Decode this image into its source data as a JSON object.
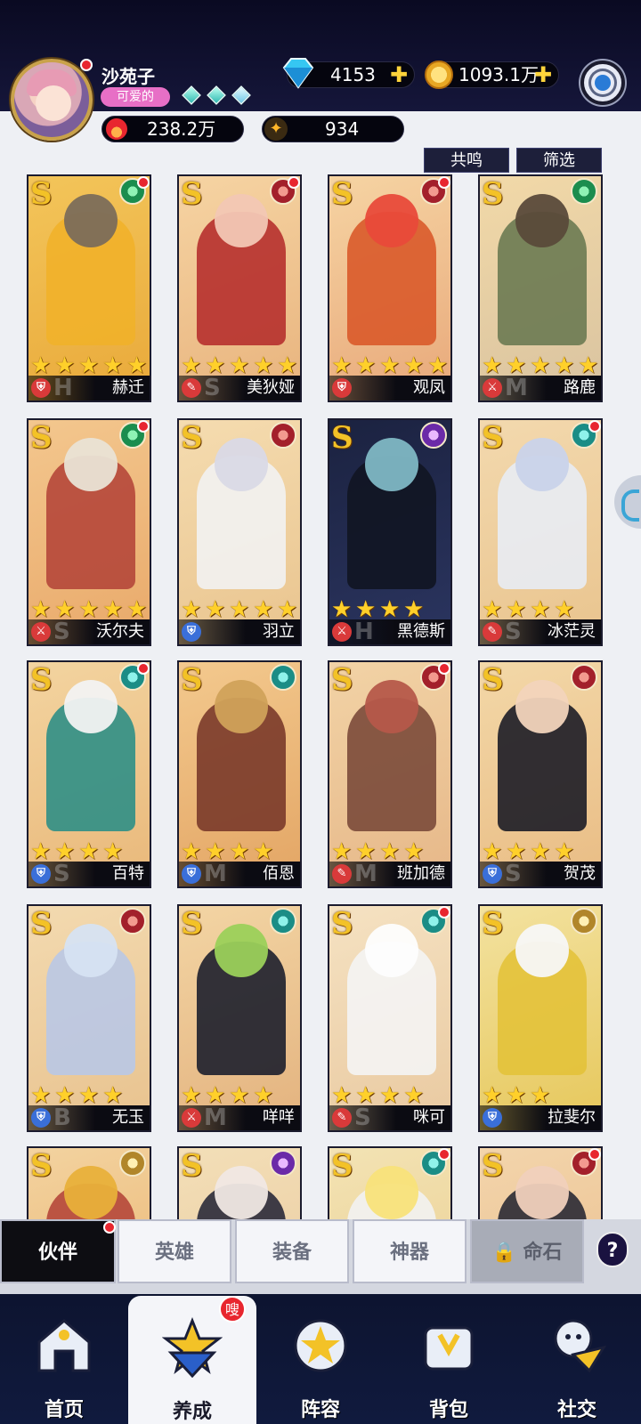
{
  "player": {
    "name": "沙苑子",
    "title": "可爱的",
    "diamonds": "4153",
    "gold": "1093.1万",
    "power": "238.2万",
    "stars": "934"
  },
  "buttons": {
    "resonance": "共鸣",
    "filter": "筛选"
  },
  "heroes": [
    {
      "name": "赫迁",
      "grade": "S",
      "element": "green",
      "role": "shield",
      "stars": 5,
      "letters": "H",
      "dot": true,
      "bg": [
        "#f3c55a",
        "#e9a93a"
      ],
      "fig": "#f1b12a",
      "head": "#7b6d5a"
    },
    {
      "name": "美狄娅",
      "grade": "S",
      "element": "red",
      "role": "wand",
      "stars": 5,
      "letters": "S",
      "dot": true,
      "bg": [
        "#f6d4a3",
        "#e8b37d"
      ],
      "fig": "#b6302e",
      "head": "#f2c7b4"
    },
    {
      "name": "观凤",
      "grade": "S",
      "element": "red",
      "role": "shield",
      "stars": 5,
      "letters": "",
      "dot": true,
      "bg": [
        "#f6d4a3",
        "#e8a87a"
      ],
      "fig": "#d95a2a",
      "head": "#e84a3a"
    },
    {
      "name": "路鹿",
      "grade": "S",
      "element": "green",
      "role": "sword",
      "stars": 5,
      "letters": "M",
      "dot": false,
      "bg": [
        "#f2d9a8",
        "#d9c3a0"
      ],
      "fig": "#6b7a52",
      "head": "#5a4a3a"
    },
    {
      "name": "沃尔夫",
      "grade": "S",
      "element": "green",
      "role": "sword",
      "stars": 5,
      "letters": "S",
      "dot": true,
      "bg": [
        "#f3c78e",
        "#e9a96a"
      ],
      "fig": "#b5473a",
      "head": "#e9e3d5"
    },
    {
      "name": "羽立",
      "grade": "S",
      "element": "red",
      "role": "blue",
      "stars": 5,
      "letters": "",
      "dot": false,
      "bg": [
        "#f5dcb0",
        "#e9c48e"
      ],
      "fig": "#f2f2f2",
      "head": "#d9d9e6"
    },
    {
      "name": "黑德斯",
      "grade": "S",
      "element": "purple",
      "role": "sword",
      "stars": 4,
      "letters": "H",
      "dot": false,
      "bg": [
        "#1b2240",
        "#2b3560"
      ],
      "fig": "#111522",
      "head": "#7fb7c4"
    },
    {
      "name": "冰茫灵",
      "grade": "S",
      "element": "teal",
      "role": "wand",
      "stars": 4,
      "letters": "S",
      "dot": true,
      "bg": [
        "#f3d9ae",
        "#e9c48e"
      ],
      "fig": "#e8ecf4",
      "head": "#c9d3ea"
    },
    {
      "name": "百特",
      "grade": "S",
      "element": "teal",
      "role": "blue",
      "stars": 4,
      "letters": "S",
      "dot": true,
      "bg": [
        "#f3d4a0",
        "#e9b87a"
      ],
      "fig": "#2f8f86",
      "head": "#f2f2f2"
    },
    {
      "name": "佰恩",
      "grade": "S",
      "element": "teal",
      "role": "blue",
      "stars": 4,
      "letters": "M",
      "dot": false,
      "bg": [
        "#f3c98e",
        "#e3a564"
      ],
      "fig": "#7a3a2a",
      "head": "#d0a25a"
    },
    {
      "name": "班加德",
      "grade": "S",
      "element": "red",
      "role": "wand",
      "stars": 4,
      "letters": "M",
      "dot": true,
      "bg": [
        "#f2d3a6",
        "#e6b788"
      ],
      "fig": "#7b4a3a",
      "head": "#b5584a"
    },
    {
      "name": "贺茂",
      "grade": "S",
      "element": "red",
      "role": "blue",
      "stars": 4,
      "letters": "S",
      "dot": false,
      "bg": [
        "#f3d8a8",
        "#e9bc84"
      ],
      "fig": "#1c1c26",
      "head": "#f2d4bc"
    },
    {
      "name": "无玉",
      "grade": "S",
      "element": "red",
      "role": "blue",
      "stars": 4,
      "letters": "B",
      "dot": false,
      "bg": [
        "#f3dab0",
        "#e8c28e"
      ],
      "fig": "#b9c8e6",
      "head": "#d6e3f2"
    },
    {
      "name": "咩咩",
      "grade": "S",
      "element": "teal",
      "role": "sword",
      "stars": 4,
      "letters": "M",
      "dot": false,
      "bg": [
        "#f3d5a4",
        "#e3b27e"
      ],
      "fig": "#1d1f2c",
      "head": "#9bd05a"
    },
    {
      "name": "咪可",
      "grade": "S",
      "element": "teal",
      "role": "wand",
      "stars": 4,
      "letters": "S",
      "dot": true,
      "bg": [
        "#f5e2c2",
        "#e9c9a0"
      ],
      "fig": "#f4f4f4",
      "head": "#fdfdfd"
    },
    {
      "name": "拉斐尔",
      "grade": "S",
      "element": "gold",
      "role": "blue",
      "stars": 3,
      "letters": "",
      "dot": false,
      "bg": [
        "#f3e2a0",
        "#e6c75a"
      ],
      "fig": "#e3c23a",
      "head": "#f7f7f7"
    },
    {
      "name": "",
      "grade": "S",
      "element": "gold",
      "role": "none",
      "stars": 0,
      "letters": "",
      "dot": false,
      "bg": [
        "#f3d3a0",
        "#e9b06a"
      ],
      "fig": "#b5473a",
      "head": "#e8b03a"
    },
    {
      "name": "",
      "grade": "S",
      "element": "purple",
      "role": "none",
      "stars": 0,
      "letters": "",
      "dot": false,
      "bg": [
        "#f3dfb8",
        "#e9c79a"
      ],
      "fig": "#2a2a3a",
      "head": "#f0e8e4"
    },
    {
      "name": "",
      "grade": "S",
      "element": "teal",
      "role": "none",
      "stars": 0,
      "letters": "",
      "dot": true,
      "bg": [
        "#f3e3b4",
        "#e9cb8c"
      ],
      "fig": "#f2f2f2",
      "head": "#f8e27a"
    },
    {
      "name": "",
      "grade": "S",
      "element": "red",
      "role": "none",
      "stars": 0,
      "letters": "",
      "dot": true,
      "bg": [
        "#f3d5ac",
        "#e9bb88"
      ],
      "fig": "#2a2a34",
      "head": "#f0d0bc"
    }
  ],
  "subtabs": [
    {
      "label": "伙伴",
      "state": "active"
    },
    {
      "label": "英雄",
      "state": "normal"
    },
    {
      "label": "装备",
      "state": "normal"
    },
    {
      "label": "神器",
      "state": "normal"
    },
    {
      "label": "命石",
      "state": "locked"
    }
  ],
  "help": "?",
  "nav": [
    {
      "label": "首页",
      "icon": "home-icon"
    },
    {
      "label": "养成",
      "icon": "train-icon",
      "active": true
    },
    {
      "label": "阵容",
      "icon": "lineup-icon"
    },
    {
      "label": "背包",
      "icon": "bag-icon"
    },
    {
      "label": "社交",
      "icon": "social-icon"
    }
  ],
  "nav_badge": "嗖",
  "colors": {
    "header_bg": "#0a0a22",
    "accent_gold": "#f3c227",
    "alert_red": "#e8262f",
    "title_pink": "#e76fc6"
  }
}
